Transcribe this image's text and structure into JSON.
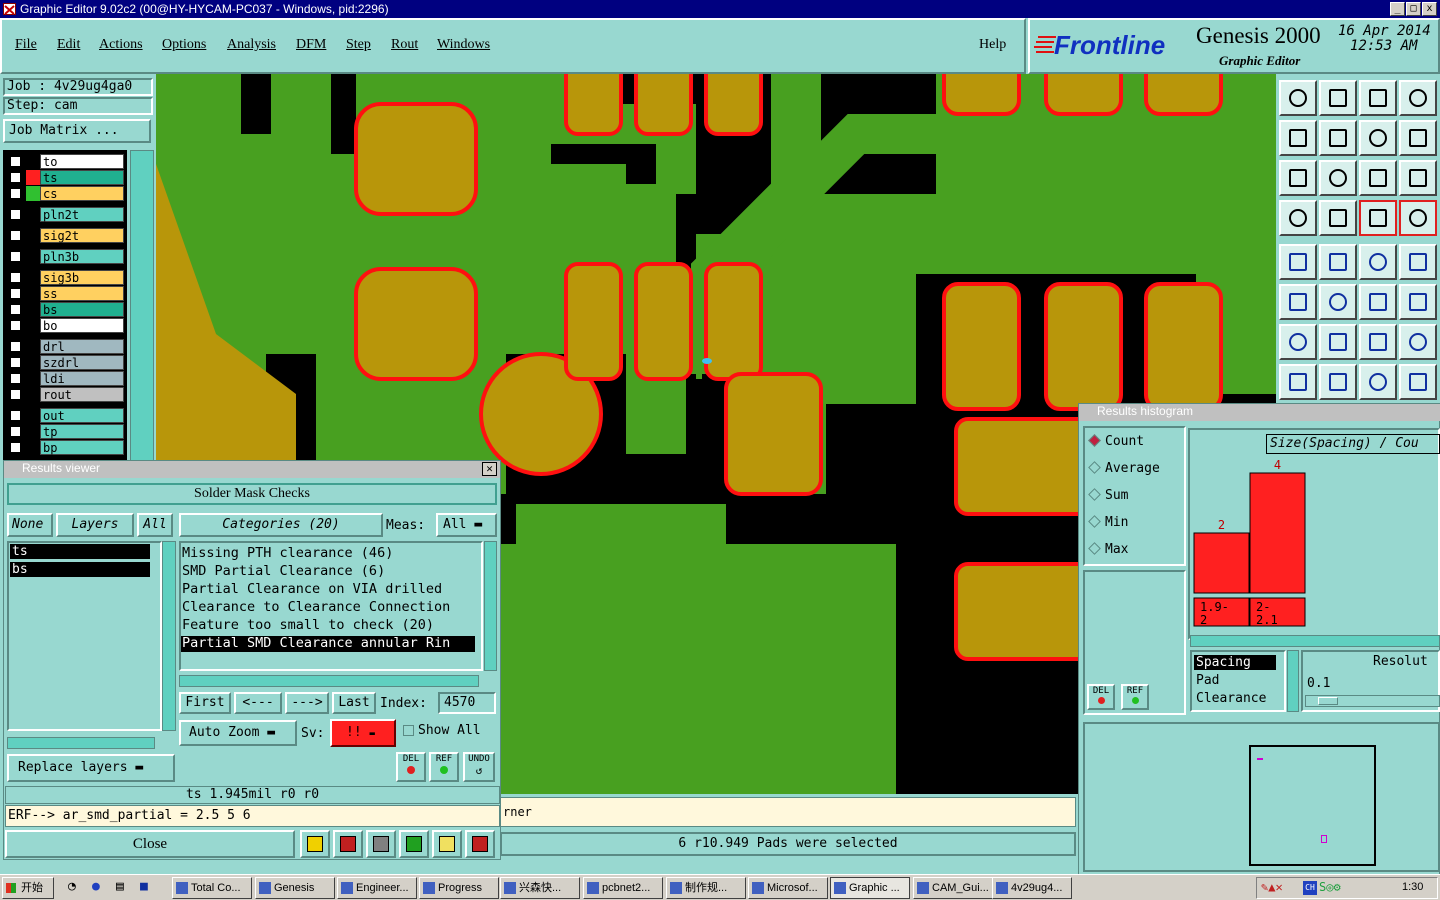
{
  "window": {
    "title": "Graphic Editor 9.02c2 (00@HY-HYCAM-PC037 - Windows, pid:2296)"
  },
  "menu": [
    "File",
    "Edit",
    "Actions",
    "Options",
    "Analysis",
    "DFM",
    "Step",
    "Rout",
    "Windows"
  ],
  "help": "Help",
  "brand": {
    "logo": "Frontline",
    "product": "Genesis 2000",
    "subtitle": "Graphic Editor",
    "date": "16 Apr 2014",
    "time": "12:53 AM"
  },
  "job": {
    "job_label": "Job : 4v29ug4ga0",
    "step_label": "Step: cam",
    "matrix_button": "Job Matrix ..."
  },
  "layers": [
    {
      "name": "to",
      "color": "#ffffff"
    },
    {
      "name": "ts",
      "color": "#20b090"
    },
    {
      "name": "cs",
      "color": "#ffd060"
    },
    {
      "name": "pln2t",
      "color": "#60d0c0"
    },
    {
      "name": "sig2t",
      "color": "#ffd060"
    },
    {
      "name": "pln3b",
      "color": "#60d0c0"
    },
    {
      "name": "sig3b",
      "color": "#ffd060"
    },
    {
      "name": "ss",
      "color": "#ffd060"
    },
    {
      "name": "bs",
      "color": "#20b090"
    },
    {
      "name": "bo",
      "color": "#ffffff"
    },
    {
      "name": "drl",
      "color": "#a0b8c0"
    },
    {
      "name": "szdrl",
      "color": "#a0b8c0"
    },
    {
      "name": "ldi",
      "color": "#a0b8c0"
    },
    {
      "name": "rout",
      "color": "#c0c0c0"
    },
    {
      "name": "out",
      "color": "#60d0c0"
    },
    {
      "name": "tp",
      "color": "#60d0c0"
    },
    {
      "name": "bp",
      "color": "#60d0c0"
    }
  ],
  "results_viewer": {
    "title": "Results viewer",
    "header": "Solder Mask Checks",
    "none_btn": "None",
    "layers_btn": "Layers",
    "all_btn": "All",
    "layer_list": [
      "ts",
      "bs"
    ],
    "categories_btn": "Categories (20)",
    "meas_label": "Meas:",
    "meas_value": "All",
    "categories": [
      "Missing PTH clearance (46)",
      "SMD Partial Clearance (6)",
      "Partial Clearance on VIA drilled",
      "Clearance to Clearance Connection",
      "Feature too small to check (20)",
      "Partial SMD Clearance annular Rin"
    ],
    "first": "First",
    "prev": "<---",
    "next": "--->",
    "last": "Last",
    "index_label": "Index:",
    "index_value": "4570",
    "auto_zoom": "Auto Zoom",
    "sv_label": "Sv:",
    "sv_value": "!!",
    "show_all": "Show All",
    "replace_layers": "Replace layers",
    "del": "DEL",
    "ref": "REF",
    "undo": "UNDO",
    "status": "ts 1.945mil  r0  r0",
    "erf": "ERF--> ar_smd_partial = 2.5 5 6",
    "close": "Close"
  },
  "histogram": {
    "title": "Results histogram",
    "modes": [
      "Count",
      "Average",
      "Sum",
      "Min",
      "Max"
    ],
    "selected_mode": "Count",
    "axis_title": "Size(Spacing) / Cou",
    "bar_labels": [
      "1.9-\n 2",
      "2-\n 2.1"
    ],
    "bar_counts": [
      "2",
      "4"
    ],
    "list": [
      "Spacing",
      "Pad",
      "Clearance"
    ],
    "resolution_label": "Resolut",
    "resolution_value": "0.1",
    "del": "DEL",
    "ref": "REF"
  },
  "chart_data": {
    "type": "bar",
    "categories": [
      "1.9-2",
      "2-2.1"
    ],
    "values": [
      2,
      4
    ],
    "title": "Size(Spacing) / Cou",
    "color": "#ff2020"
  },
  "status_line": "6 r10.949 Pads were selected",
  "message_fragment": "rner",
  "taskbar": {
    "start": "开始",
    "items": [
      "Total Co...",
      "Genesis",
      "Engineer...",
      "Progress",
      "兴森快...",
      "pcbnet2...",
      "制作规...",
      "Microsof...",
      "Graphic ...",
      "CAM_Gui...",
      "4v29ug4..."
    ],
    "clock": "1:30"
  },
  "colors": {
    "copper": "#b8960a",
    "mask": "#48a020",
    "clearance_edge": "#ff1010",
    "background": "#98d8d0",
    "accent_red": "#ff2020"
  }
}
